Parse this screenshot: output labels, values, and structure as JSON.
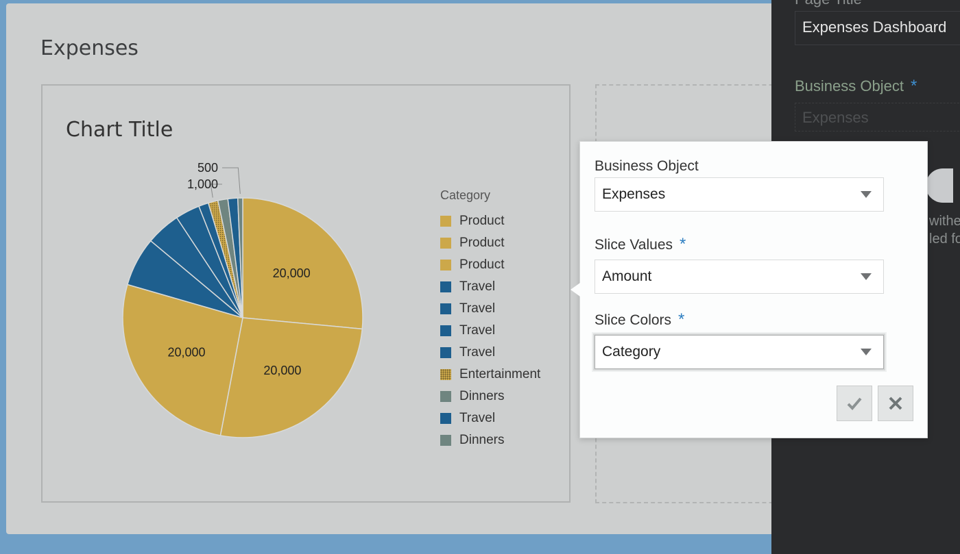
{
  "page": {
    "title": "Expenses"
  },
  "chart_data": {
    "type": "pie",
    "title": "Chart Title",
    "legend_title": "Category",
    "legend_position": "right",
    "slices": [
      {
        "category": "Product",
        "value": 20000,
        "label": "20,000",
        "color": "#cca84a"
      },
      {
        "category": "Product",
        "value": 20000,
        "label": "20,000",
        "color": "#cca84a"
      },
      {
        "category": "Product",
        "value": 20000,
        "label": "20,000",
        "color": "#cca84a"
      },
      {
        "category": "Travel",
        "value": 5000,
        "label": "",
        "color": "#1e5f8e"
      },
      {
        "category": "Travel",
        "value": 3500,
        "label": "",
        "color": "#1e5f8e"
      },
      {
        "category": "Travel",
        "value": 2500,
        "label": "",
        "color": "#1e5f8e"
      },
      {
        "category": "Travel",
        "value": 1000,
        "label": "",
        "color": "#1e5f8e"
      },
      {
        "category": "Entertainment",
        "value": 1000,
        "label": "1,000",
        "color": "#cca84a",
        "pattern": "dotted"
      },
      {
        "category": "Dinners",
        "value": 1000,
        "label": "",
        "color": "#6f8580"
      },
      {
        "category": "Travel",
        "value": 1000,
        "label": "",
        "color": "#1e5f8e"
      },
      {
        "category": "Dinners",
        "value": 500,
        "label": "500",
        "color": "#6f8580"
      }
    ]
  },
  "popup": {
    "business_object": {
      "label": "Business Object",
      "value": "Expenses"
    },
    "slice_values": {
      "label": "Slice Values",
      "required": "*",
      "value": "Amount"
    },
    "slice_colors": {
      "label": "Slice Colors",
      "required": "*",
      "value": "Category"
    },
    "confirm_icon": "check-icon",
    "cancel_icon": "close-icon"
  },
  "side_panel": {
    "page_title_label": "Page Title",
    "page_title_value": "Expenses Dashboard",
    "business_object_label": "Business Object",
    "business_object_required": "*",
    "business_object_value": "Expenses",
    "text_line1": "withe",
    "text_line2": "led fo"
  }
}
